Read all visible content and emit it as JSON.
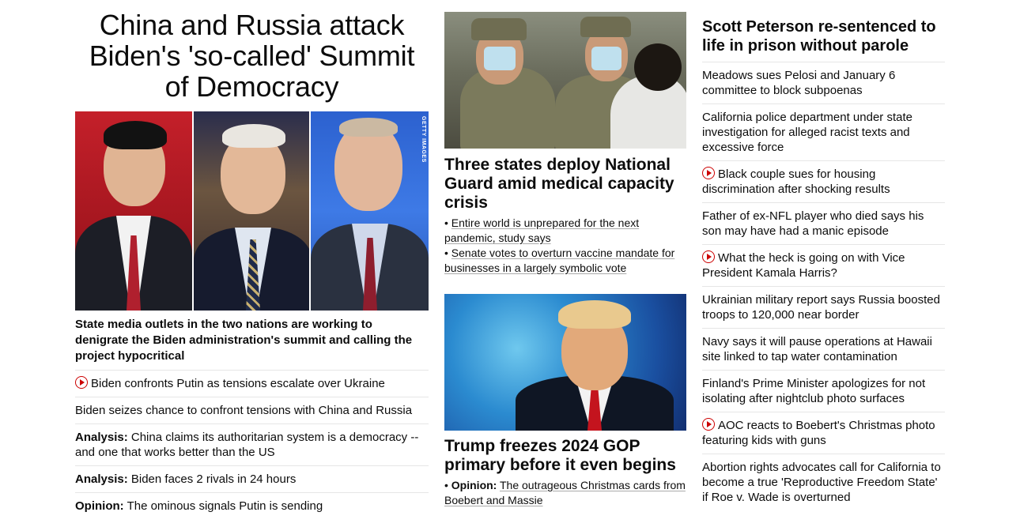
{
  "hero": {
    "title": "China and Russia attack Biden's 'so-called' Summit of Democracy",
    "image_credit": "GETTY IMAGES",
    "dek": "State media outlets in the two nations are working to denigrate the Biden administration's summit and calling the project hypocritical",
    "links": [
      {
        "label": "",
        "text": "Biden confronts Putin as tensions escalate over Ukraine",
        "video": true
      },
      {
        "label": "",
        "text": "Biden seizes chance to confront tensions with China and Russia",
        "video": false
      },
      {
        "label": "Analysis:",
        "text": "China claims its authoritarian system is a democracy -- and one that works better than the US",
        "video": false
      },
      {
        "label": "Analysis:",
        "text": "Biden faces 2 rivals in 24 hours",
        "video": false
      },
      {
        "label": "Opinion:",
        "text": "The ominous signals Putin is sending",
        "video": false
      }
    ]
  },
  "middle": {
    "story1": {
      "headline": "Three states deploy National Guard amid medical capacity crisis",
      "links": [
        "Entire world is unprepared for the next pandemic, study says",
        "Senate votes to overturn vaccine mandate for businesses in a largely symbolic vote"
      ]
    },
    "story2": {
      "headline": "Trump freezes 2024 GOP primary before it even begins",
      "links": [
        {
          "label": "Opinion:",
          "text": "The outrageous Christmas cards from Boebert and Massie"
        }
      ]
    },
    "bullet": "•"
  },
  "right": {
    "headline": "Scott Peterson re-sentenced to life in prison without parole",
    "links": [
      {
        "text": "Meadows sues Pelosi and January 6 committee to block subpoenas",
        "video": false
      },
      {
        "text": "California police department under state investigation for alleged racist texts and excessive force",
        "video": false
      },
      {
        "text": "Black couple sues for housing discrimination after shocking results",
        "video": true
      },
      {
        "text": "Father of ex-NFL player who died says his son may have had a manic episode",
        "video": false
      },
      {
        "text": "What the heck is going on with Vice President Kamala Harris?",
        "video": true
      },
      {
        "text": "Ukrainian military report says Russia boosted troops to 120,000 near border",
        "video": false
      },
      {
        "text": "Navy says it will pause operations at Hawaii site linked to tap water contamination",
        "video": false
      },
      {
        "text": "Finland's Prime Minister apologizes for not isolating after nightclub photo surfaces",
        "video": false
      },
      {
        "text": "AOC reacts to Boebert's Christmas photo featuring kids with guns",
        "video": true
      },
      {
        "text": "Abortion rights advocates call for California to become a true 'Reproductive Freedom State' if Roe v. Wade is overturned",
        "video": false
      }
    ]
  },
  "colors": {
    "accent_red": "#cc0000",
    "divider": "#e6e6e6",
    "text": "#0c0c0c"
  }
}
